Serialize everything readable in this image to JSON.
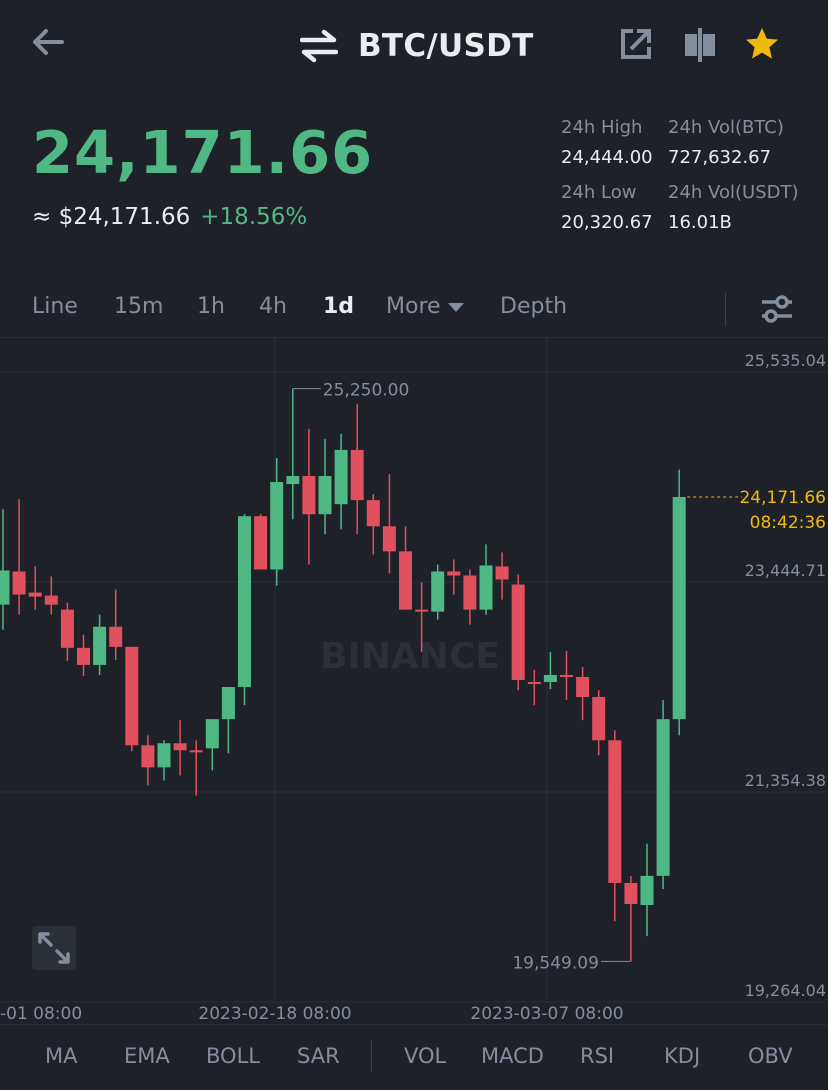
{
  "header": {
    "pair": "BTC/USDT",
    "icons": [
      "back-arrow-icon",
      "swap-arrows-icon",
      "share-icon",
      "compare-icon",
      "star-icon"
    ],
    "star_color": "#f0b90b"
  },
  "price": {
    "last": "24,171.66",
    "approx_label": "≈ $24,171.66",
    "change_pct": "+18.56%"
  },
  "stats": {
    "high_label": "24h High",
    "high_value": "24,444.00",
    "vol_btc_label": "24h Vol(BTC)",
    "vol_btc_value": "727,632.67",
    "low_label": "24h Low",
    "low_value": "20,320.67",
    "vol_usdt_label": "24h Vol(USDT)",
    "vol_usdt_value": "16.01B"
  },
  "tabs": [
    {
      "label": "Line",
      "active": false
    },
    {
      "label": "15m",
      "active": false
    },
    {
      "label": "1h",
      "active": false
    },
    {
      "label": "4h",
      "active": false
    },
    {
      "label": "1d",
      "active": true
    },
    {
      "label": "More",
      "active": false
    },
    {
      "label": "Depth",
      "active": false
    }
  ],
  "indicators": [
    "MA",
    "EMA",
    "BOLL",
    "SAR",
    "VOL",
    "MACD",
    "RSI",
    "KDJ",
    "OBV"
  ],
  "colors": {
    "up": "#4fb884",
    "down": "#e0515d",
    "background": "#1f2129",
    "accent": "#f0b90b"
  },
  "chart_data": {
    "type": "candlestick",
    "watermark": "BINANCE",
    "y_ticks": [
      "25,535.04",
      "23,444.71",
      "21,354.38",
      "19,264.04"
    ],
    "y_tick_values": [
      25535.04,
      23444.71,
      21354.38,
      19264.04
    ],
    "x_ticks": [
      "-01 08:00",
      "2023-02-18 08:00",
      "2023-03-07 08:00"
    ],
    "ylim": [
      19264.04,
      25535.04
    ],
    "current_price": 24171.66,
    "current_price_label": "24,171.66",
    "countdown": "08:42:36",
    "high_marker": "25,250.00",
    "low_marker": "19,549.09",
    "candles": [
      {
        "o": 23100,
        "h": 24050,
        "l": 22850,
        "c": 23440
      },
      {
        "o": 23430,
        "h": 24150,
        "l": 23000,
        "c": 23200
      },
      {
        "o": 23220,
        "h": 23480,
        "l": 23050,
        "c": 23180
      },
      {
        "o": 23190,
        "h": 23380,
        "l": 23000,
        "c": 23100
      },
      {
        "o": 23050,
        "h": 23120,
        "l": 22540,
        "c": 22670
      },
      {
        "o": 22670,
        "h": 22800,
        "l": 22390,
        "c": 22500
      },
      {
        "o": 22500,
        "h": 23000,
        "l": 22400,
        "c": 22880
      },
      {
        "o": 22880,
        "h": 23250,
        "l": 22550,
        "c": 22680
      },
      {
        "o": 22680,
        "h": 22680,
        "l": 21640,
        "c": 21700
      },
      {
        "o": 21700,
        "h": 21800,
        "l": 21300,
        "c": 21480
      },
      {
        "o": 21480,
        "h": 21750,
        "l": 21350,
        "c": 21720
      },
      {
        "o": 21720,
        "h": 21950,
        "l": 21400,
        "c": 21650
      },
      {
        "o": 21650,
        "h": 21750,
        "l": 21200,
        "c": 21640
      },
      {
        "o": 21670,
        "h": 21900,
        "l": 21450,
        "c": 21960
      },
      {
        "o": 21960,
        "h": 22240,
        "l": 21620,
        "c": 22280
      },
      {
        "o": 22280,
        "h": 24000,
        "l": 22100,
        "c": 23980
      },
      {
        "o": 23980,
        "h": 24000,
        "l": 23450,
        "c": 23450
      },
      {
        "o": 23450,
        "h": 24560,
        "l": 23290,
        "c": 24320
      },
      {
        "o": 24300,
        "h": 25250,
        "l": 23950,
        "c": 24380
      },
      {
        "o": 24380,
        "h": 24850,
        "l": 23500,
        "c": 24000
      },
      {
        "o": 24000,
        "h": 24750,
        "l": 23800,
        "c": 24380
      },
      {
        "o": 24100,
        "h": 24800,
        "l": 23850,
        "c": 24640
      },
      {
        "o": 24640,
        "h": 25100,
        "l": 23800,
        "c": 24140
      },
      {
        "o": 24140,
        "h": 24200,
        "l": 23600,
        "c": 23880
      },
      {
        "o": 23880,
        "h": 24400,
        "l": 23410,
        "c": 23630
      },
      {
        "o": 23630,
        "h": 23880,
        "l": 23300,
        "c": 23050
      },
      {
        "o": 23050,
        "h": 23320,
        "l": 22630,
        "c": 23030
      },
      {
        "o": 23030,
        "h": 23500,
        "l": 22950,
        "c": 23430
      },
      {
        "o": 23430,
        "h": 23550,
        "l": 23200,
        "c": 23390
      },
      {
        "o": 23390,
        "h": 23450,
        "l": 22900,
        "c": 23050
      },
      {
        "o": 23050,
        "h": 23700,
        "l": 23000,
        "c": 23490
      },
      {
        "o": 23480,
        "h": 23620,
        "l": 23150,
        "c": 23350
      },
      {
        "o": 23300,
        "h": 23400,
        "l": 22250,
        "c": 22350
      },
      {
        "o": 22330,
        "h": 22450,
        "l": 22100,
        "c": 22320
      },
      {
        "o": 22330,
        "h": 22630,
        "l": 22260,
        "c": 22400
      },
      {
        "o": 22400,
        "h": 22640,
        "l": 22150,
        "c": 22380
      },
      {
        "o": 22380,
        "h": 22480,
        "l": 21950,
        "c": 22180
      },
      {
        "o": 22180,
        "h": 22250,
        "l": 21600,
        "c": 21750
      },
      {
        "o": 21750,
        "h": 21850,
        "l": 19950,
        "c": 20330
      },
      {
        "o": 20330,
        "h": 20400,
        "l": 19549.09,
        "c": 20120
      },
      {
        "o": 20110,
        "h": 20720,
        "l": 19800,
        "c": 20400
      },
      {
        "o": 20400,
        "h": 22150,
        "l": 20270,
        "c": 21960
      },
      {
        "o": 21960,
        "h": 24444,
        "l": 21800,
        "c": 24171.66
      }
    ]
  }
}
